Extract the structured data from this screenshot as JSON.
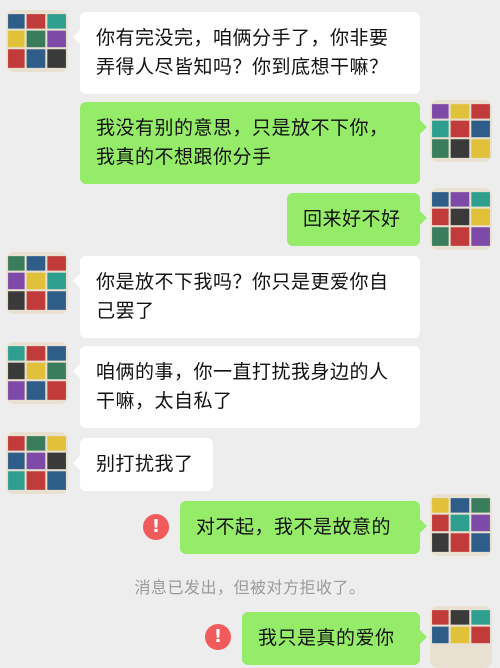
{
  "messages": [
    {
      "side": "left",
      "text": "你有完没完，咱俩分手了，你非要弄得人尽皆知吗？你到底想干嘛？"
    },
    {
      "side": "right",
      "text": "我没有别的意思，只是放不下你，我真的不想跟你分手"
    },
    {
      "side": "right",
      "text": "回来好不好"
    },
    {
      "side": "left",
      "text": "你是放不下我吗？你只是更爱你自己罢了"
    },
    {
      "side": "left",
      "text": "咱俩的事，你一直打扰我身边的人干嘛，太自私了"
    },
    {
      "side": "left",
      "text": "别打扰我了"
    },
    {
      "side": "right",
      "text": "对不起，我不是故意的",
      "failed": true
    },
    {
      "side": "right",
      "text": "我只是真的爱你",
      "failed": true
    }
  ],
  "system_notice": "消息已发出，但被对方拒收了。",
  "error_mark": "!",
  "colors": {
    "background": "#ededed",
    "incoming_bubble": "#ffffff",
    "outgoing_bubble": "#95ec69",
    "error": "#f15b5b",
    "notice_text": "#9a9a9a"
  },
  "avatars": {
    "left": "mosaic-avatar-icon",
    "right": "mosaic-avatar-icon"
  }
}
